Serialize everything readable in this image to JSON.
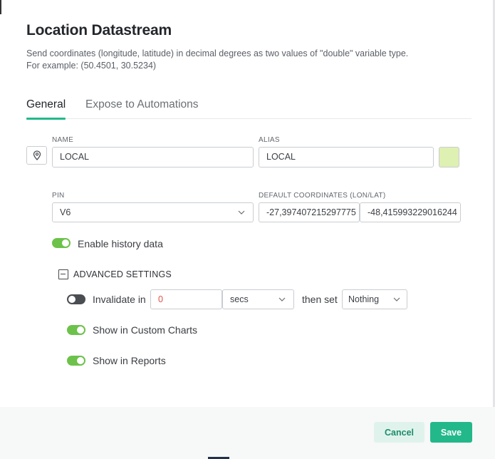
{
  "dialog": {
    "title": "Location Datastream",
    "description_line1": "Send coordinates (longitude, latitude) in decimal degrees as two values of \"double\" variable type.",
    "description_line2": "For example: (50.4501, 30.5234)"
  },
  "tabs": [
    {
      "label": "General",
      "active": true
    },
    {
      "label": "Expose to Automations",
      "active": false
    }
  ],
  "form": {
    "icon": "location-pin-icon",
    "name_label": "NAME",
    "name_value": "LOCAL",
    "alias_label": "ALIAS",
    "alias_value": "LOCAL",
    "color": "#def0b2",
    "pin_label": "PIN",
    "pin_value": "V6",
    "coords_label": "DEFAULT COORDINATES (LON/LAT)",
    "lon_value": "-27,397407215297775",
    "lat_value": "-48,415993229016244",
    "history_label": "Enable history data",
    "history_enabled": true
  },
  "advanced": {
    "label": "ADVANCED SETTINGS",
    "invalidate_label": "Invalidate in",
    "invalidate_enabled": false,
    "invalidate_value": "0",
    "unit_value": "secs",
    "then_set_label": "then set",
    "then_set_value": "Nothing",
    "custom_charts_label": "Show in Custom Charts",
    "custom_charts_enabled": true,
    "reports_label": "Show in Reports",
    "reports_enabled": true
  },
  "footer": {
    "cancel_label": "Cancel",
    "save_label": "Save"
  },
  "colors": {
    "accent": "#23b88a",
    "toggle_on": "#6cc24a",
    "invalid_value": "#e0524a"
  }
}
